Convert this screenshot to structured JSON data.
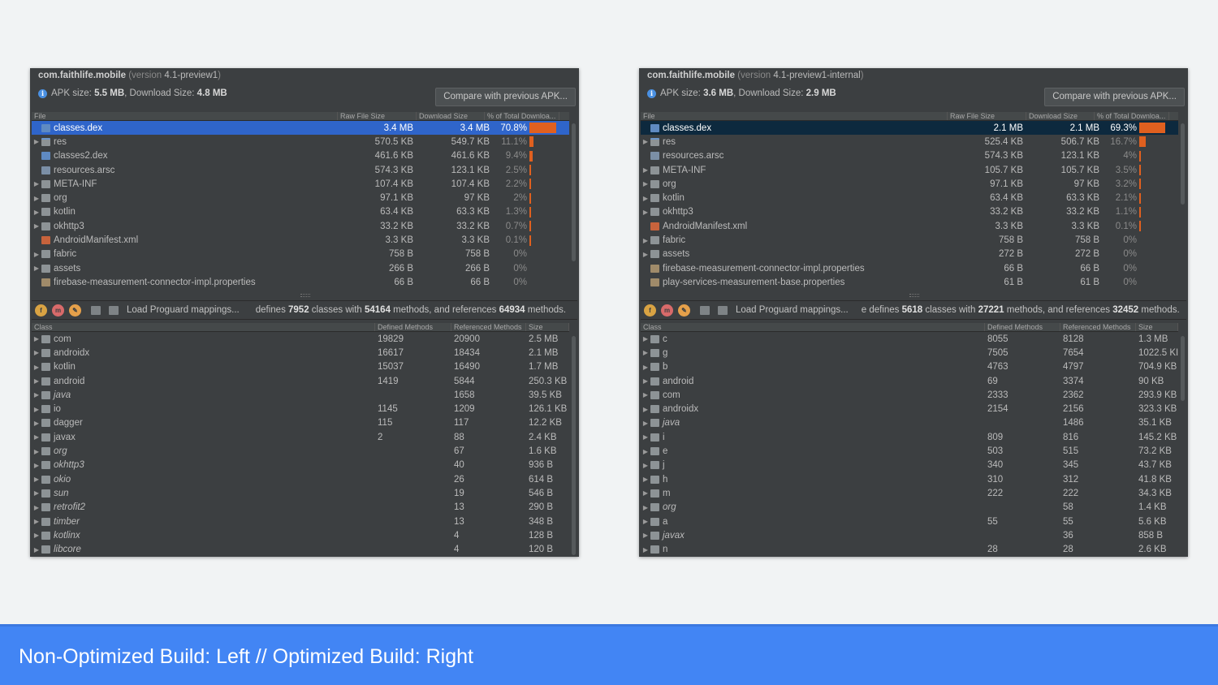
{
  "colors": {
    "accent": "#e0601f",
    "selection_left": "#2f65ca",
    "selection_right": "#0d293e",
    "footer": "#4285f4",
    "panel_bg": "#3c3f41"
  },
  "left": {
    "package": "com.faithlife.mobile",
    "version_prefix": "(version ",
    "version": "4.1-preview1",
    "version_suffix": ")",
    "apk_label": "APK size: ",
    "apk_size": "5.5 MB",
    "download_label": ", Download Size: ",
    "download_size": "4.8 MB",
    "compare_button": "Compare with previous APK...",
    "file_headers": [
      "File",
      "Raw File Size",
      "Download Size",
      "% of Total Downloa..."
    ],
    "files": [
      {
        "arrow": "",
        "icon": "dex-icon",
        "name": "classes.dex",
        "raw": "3.4 MB",
        "dl": "3.4 MB",
        "pct": "70.8%",
        "share": 70.8,
        "selected": true
      },
      {
        "arrow": "▶",
        "icon": "res-folder-icon",
        "name": "res",
        "raw": "570.5 KB",
        "dl": "549.7 KB",
        "pct": "11.1%",
        "share": 11.1
      },
      {
        "arrow": "",
        "icon": "dex-icon",
        "name": "classes2.dex",
        "raw": "461.6 KB",
        "dl": "461.6 KB",
        "pct": "9.4%",
        "share": 9.4
      },
      {
        "arrow": "",
        "icon": "arsc-icon",
        "name": "resources.arsc",
        "raw": "574.3 KB",
        "dl": "123.1 KB",
        "pct": "2.5%",
        "share": 2.5
      },
      {
        "arrow": "▶",
        "icon": "folder-icon",
        "name": "META-INF",
        "raw": "107.4 KB",
        "dl": "107.4 KB",
        "pct": "2.2%",
        "share": 2.2
      },
      {
        "arrow": "▶",
        "icon": "folder-icon",
        "name": "org",
        "raw": "97.1 KB",
        "dl": "97 KB",
        "pct": "2%",
        "share": 2.0
      },
      {
        "arrow": "▶",
        "icon": "folder-icon",
        "name": "kotlin",
        "raw": "63.4 KB",
        "dl": "63.3 KB",
        "pct": "1.3%",
        "share": 1.3
      },
      {
        "arrow": "▶",
        "icon": "folder-icon",
        "name": "okhttp3",
        "raw": "33.2 KB",
        "dl": "33.2 KB",
        "pct": "0.7%",
        "share": 0.7
      },
      {
        "arrow": "",
        "icon": "xml-icon",
        "name": "AndroidManifest.xml",
        "raw": "3.3 KB",
        "dl": "3.3 KB",
        "pct": "0.1%",
        "share": 0.1
      },
      {
        "arrow": "▶",
        "icon": "folder-icon",
        "name": "fabric",
        "raw": "758 B",
        "dl": "758 B",
        "pct": "0%",
        "share": 0
      },
      {
        "arrow": "▶",
        "icon": "folder-icon",
        "name": "assets",
        "raw": "266 B",
        "dl": "266 B",
        "pct": "0%",
        "share": 0
      },
      {
        "arrow": "",
        "icon": "properties-icon",
        "name": "firebase-measurement-connector-impl.properties",
        "raw": "66 B",
        "dl": "66 B",
        "pct": "0%",
        "share": 0
      }
    ],
    "load_proguard": "Load Proguard mappings...",
    "summary": {
      "prefix": "defines ",
      "classes": "7952",
      "mid1": " classes with ",
      "methods": "54164",
      "mid2": " methods, and references ",
      "refs": "64934",
      "suffix": " methods."
    },
    "class_headers": [
      "Class",
      "Defined Methods",
      "Referenced Methods",
      "Size"
    ],
    "classes": [
      {
        "name": "com",
        "defined": "19829",
        "referenced": "20900",
        "size": "2.5 MB",
        "italic": false
      },
      {
        "name": "androidx",
        "defined": "16617",
        "referenced": "18434",
        "size": "2.1 MB",
        "italic": false
      },
      {
        "name": "kotlin",
        "defined": "15037",
        "referenced": "16490",
        "size": "1.7 MB",
        "italic": false
      },
      {
        "name": "android",
        "defined": "1419",
        "referenced": "5844",
        "size": "250.3 KB",
        "italic": false
      },
      {
        "name": "java",
        "defined": "",
        "referenced": "1658",
        "size": "39.5 KB",
        "italic": true
      },
      {
        "name": "io",
        "defined": "1145",
        "referenced": "1209",
        "size": "126.1 KB",
        "italic": false
      },
      {
        "name": "dagger",
        "defined": "115",
        "referenced": "117",
        "size": "12.2 KB",
        "italic": false
      },
      {
        "name": "javax",
        "defined": "2",
        "referenced": "88",
        "size": "2.4 KB",
        "italic": false
      },
      {
        "name": "org",
        "defined": "",
        "referenced": "67",
        "size": "1.6 KB",
        "italic": true
      },
      {
        "name": "okhttp3",
        "defined": "",
        "referenced": "40",
        "size": "936 B",
        "italic": true
      },
      {
        "name": "okio",
        "defined": "",
        "referenced": "26",
        "size": "614 B",
        "italic": true
      },
      {
        "name": "sun",
        "defined": "",
        "referenced": "19",
        "size": "546 B",
        "italic": true
      },
      {
        "name": "retrofit2",
        "defined": "",
        "referenced": "13",
        "size": "290 B",
        "italic": true
      },
      {
        "name": "timber",
        "defined": "",
        "referenced": "13",
        "size": "348 B",
        "italic": true
      },
      {
        "name": "kotlinx",
        "defined": "",
        "referenced": "4",
        "size": "128 B",
        "italic": true
      },
      {
        "name": "libcore",
        "defined": "",
        "referenced": "4",
        "size": "120 B",
        "italic": true
      }
    ]
  },
  "right": {
    "package": "com.faithlife.mobile",
    "version_prefix": "(version ",
    "version": "4.1-preview1-internal",
    "version_suffix": ")",
    "apk_label": "APK size: ",
    "apk_size": "3.6 MB",
    "download_label": ", Download Size: ",
    "download_size": "2.9 MB",
    "compare_button": "Compare with previous APK...",
    "file_headers": [
      "File",
      "Raw File Size",
      "Download Size",
      "% of Total Downloa..."
    ],
    "files": [
      {
        "arrow": "",
        "icon": "dex-icon",
        "name": "classes.dex",
        "raw": "2.1 MB",
        "dl": "2.1 MB",
        "pct": "69.3%",
        "share": 69.3,
        "selected": true
      },
      {
        "arrow": "▶",
        "icon": "res-folder-icon",
        "name": "res",
        "raw": "525.4 KB",
        "dl": "506.7 KB",
        "pct": "16.7%",
        "share": 16.7
      },
      {
        "arrow": "",
        "icon": "arsc-icon",
        "name": "resources.arsc",
        "raw": "574.3 KB",
        "dl": "123.1 KB",
        "pct": "4%",
        "share": 4.0
      },
      {
        "arrow": "▶",
        "icon": "folder-icon",
        "name": "META-INF",
        "raw": "105.7 KB",
        "dl": "105.7 KB",
        "pct": "3.5%",
        "share": 3.5
      },
      {
        "arrow": "▶",
        "icon": "folder-icon",
        "name": "org",
        "raw": "97.1 KB",
        "dl": "97 KB",
        "pct": "3.2%",
        "share": 3.2
      },
      {
        "arrow": "▶",
        "icon": "folder-icon",
        "name": "kotlin",
        "raw": "63.4 KB",
        "dl": "63.3 KB",
        "pct": "2.1%",
        "share": 2.1
      },
      {
        "arrow": "▶",
        "icon": "folder-icon",
        "name": "okhttp3",
        "raw": "33.2 KB",
        "dl": "33.2 KB",
        "pct": "1.1%",
        "share": 1.1
      },
      {
        "arrow": "",
        "icon": "xml-icon",
        "name": "AndroidManifest.xml",
        "raw": "3.3 KB",
        "dl": "3.3 KB",
        "pct": "0.1%",
        "share": 0.1
      },
      {
        "arrow": "▶",
        "icon": "folder-icon",
        "name": "fabric",
        "raw": "758 B",
        "dl": "758 B",
        "pct": "0%",
        "share": 0
      },
      {
        "arrow": "▶",
        "icon": "folder-icon",
        "name": "assets",
        "raw": "272 B",
        "dl": "272 B",
        "pct": "0%",
        "share": 0
      },
      {
        "arrow": "",
        "icon": "properties-icon",
        "name": "firebase-measurement-connector-impl.properties",
        "raw": "66 B",
        "dl": "66 B",
        "pct": "0%",
        "share": 0
      },
      {
        "arrow": "",
        "icon": "properties-icon",
        "name": "play-services-measurement-base.properties",
        "raw": "61 B",
        "dl": "61 B",
        "pct": "0%",
        "share": 0
      }
    ],
    "load_proguard": "Load Proguard mappings...",
    "summary": {
      "prefix": "e defines ",
      "classes": "5618",
      "mid1": " classes with ",
      "methods": "27221",
      "mid2": " methods, and references ",
      "refs": "32452",
      "suffix": " methods."
    },
    "class_headers": [
      "Class",
      "Defined Methods",
      "Referenced Methods",
      "Size"
    ],
    "classes": [
      {
        "name": "c",
        "defined": "8055",
        "referenced": "8128",
        "size": "1.3 MB",
        "italic": false
      },
      {
        "name": "g",
        "defined": "7505",
        "referenced": "7654",
        "size": "1022.5 KI",
        "italic": false
      },
      {
        "name": "b",
        "defined": "4763",
        "referenced": "4797",
        "size": "704.9 KB",
        "italic": false
      },
      {
        "name": "android",
        "defined": "69",
        "referenced": "3374",
        "size": "90 KB",
        "italic": false
      },
      {
        "name": "com",
        "defined": "2333",
        "referenced": "2362",
        "size": "293.9 KB",
        "italic": false
      },
      {
        "name": "androidx",
        "defined": "2154",
        "referenced": "2156",
        "size": "323.3 KB",
        "italic": false
      },
      {
        "name": "java",
        "defined": "",
        "referenced": "1486",
        "size": "35.1 KB",
        "italic": true
      },
      {
        "name": "i",
        "defined": "809",
        "referenced": "816",
        "size": "145.2 KB",
        "italic": false
      },
      {
        "name": "e",
        "defined": "503",
        "referenced": "515",
        "size": "73.2 KB",
        "italic": false
      },
      {
        "name": "j",
        "defined": "340",
        "referenced": "345",
        "size": "43.7 KB",
        "italic": false
      },
      {
        "name": "h",
        "defined": "310",
        "referenced": "312",
        "size": "41.8 KB",
        "italic": false
      },
      {
        "name": "m",
        "defined": "222",
        "referenced": "222",
        "size": "34.3 KB",
        "italic": false
      },
      {
        "name": "org",
        "defined": "",
        "referenced": "58",
        "size": "1.4 KB",
        "italic": true
      },
      {
        "name": "a",
        "defined": "55",
        "referenced": "55",
        "size": "5.6 KB",
        "italic": false
      },
      {
        "name": "javax",
        "defined": "",
        "referenced": "36",
        "size": "858 B",
        "italic": true
      },
      {
        "name": "n",
        "defined": "28",
        "referenced": "28",
        "size": "2.6 KB",
        "italic": false
      }
    ]
  },
  "footer": {
    "text": "Non-Optimized Build: Left // Optimized Build: Right"
  }
}
